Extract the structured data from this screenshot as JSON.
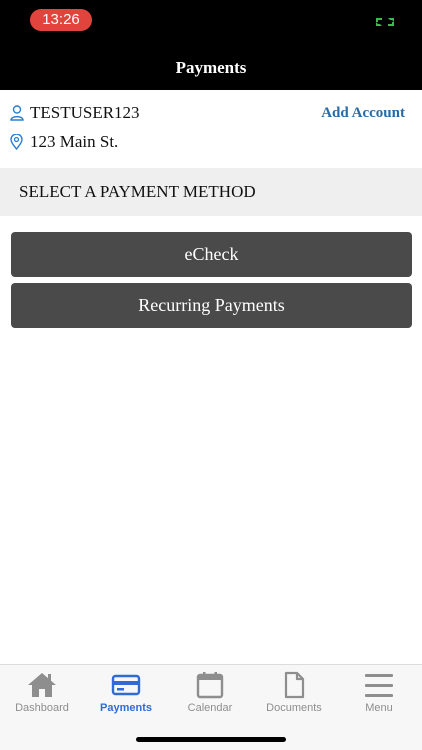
{
  "status_bar": {
    "time": "13:26"
  },
  "header": {
    "title": "Payments"
  },
  "account": {
    "username": "TESTUSER123",
    "address": "123 Main St.",
    "add_account_label": "Add Account"
  },
  "section": {
    "title": "SELECT A PAYMENT METHOD"
  },
  "payment_methods": [
    {
      "label": "eCheck"
    },
    {
      "label": "Recurring Payments"
    }
  ],
  "tabs": [
    {
      "label": "Dashboard",
      "icon": "home-icon"
    },
    {
      "label": "Payments",
      "icon": "credit-card-icon",
      "active": true
    },
    {
      "label": "Calendar",
      "icon": "calendar-icon"
    },
    {
      "label": "Documents",
      "icon": "document-icon"
    },
    {
      "label": "Menu",
      "icon": "menu-icon"
    }
  ],
  "colors": {
    "header_bg": "#000000",
    "time_pill": "#e0443c",
    "link": "#2a6aa3",
    "button_bg": "#4a4a4a",
    "tab_active": "#2f6bd3",
    "tab_inactive": "#8e8e8e"
  }
}
